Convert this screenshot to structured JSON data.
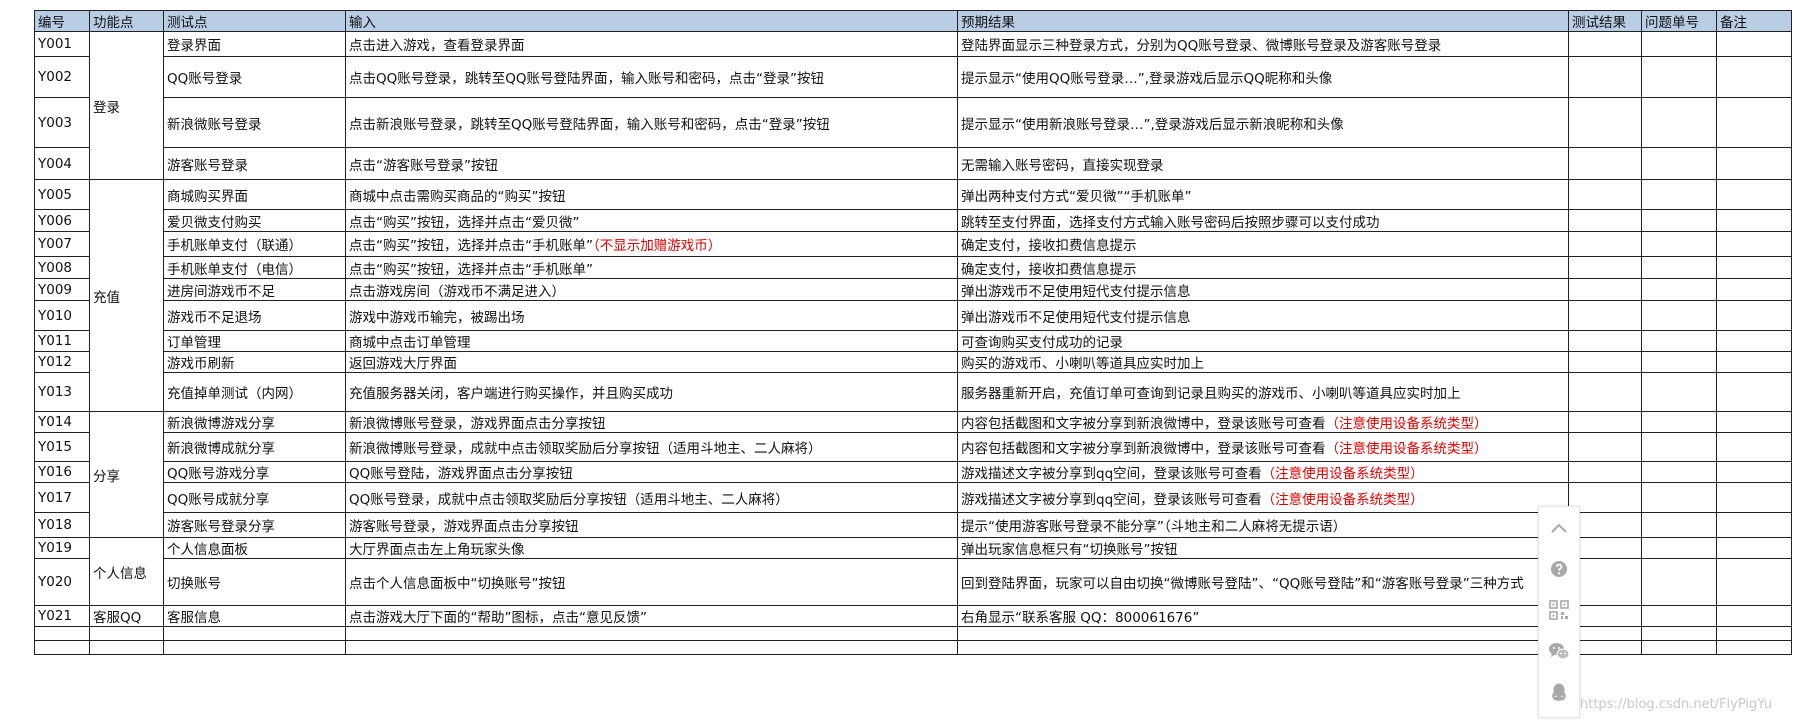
{
  "table": {
    "headers": [
      "编号",
      "功能点",
      "测试点",
      "输入",
      "预期结果",
      "测试结果",
      "问题单号",
      "备注"
    ],
    "rows": [
      {
        "id": "Y001",
        "point": "登录界面",
        "input": "点击进入游戏，查看登录界面",
        "input_note": "",
        "expected": "登陆界面显示三种登录方式，分别为QQ账号登录、微博账号登录及游客账号登录",
        "expected_note": ""
      },
      {
        "id": "Y002",
        "point": "QQ账号登录",
        "input": "点击QQ账号登录，跳转至QQ账号登陆界面，输入账号和密码，点击“登录”按钮",
        "input_note": "",
        "expected": "提示显示“使用QQ账号登录…”,登录游戏后显示QQ昵称和头像",
        "expected_note": ""
      },
      {
        "id": "Y003",
        "point": "新浪微账号登录",
        "input": "点击新浪账号登录，跳转至QQ账号登陆界面，输入账号和密码，点击“登录”按钮",
        "input_note": "",
        "expected": "提示显示“使用新浪账号登录…”,登录游戏后显示新浪昵称和头像",
        "expected_note": ""
      },
      {
        "id": "Y004",
        "point": "游客账号登录",
        "input": "点击“游客账号登录”按钮",
        "input_note": "",
        "expected": "无需输入账号密码，直接实现登录",
        "expected_note": ""
      },
      {
        "id": "Y005",
        "point": "商城购买界面",
        "input": "商城中点击需购买商品的“购买”按钮",
        "input_note": "",
        "expected": "弹出两种支付方式“爱贝微”“手机账单”",
        "expected_note": ""
      },
      {
        "id": "Y006",
        "point": "爱贝微支付购买",
        "input": "点击“购买”按钮，选择并点击“爱贝微”",
        "input_note": "",
        "expected": "跳转至支付界面，选择支付方式输入账号密码后按照步骤可以支付成功",
        "expected_note": ""
      },
      {
        "id": "Y007",
        "point": "手机账单支付（联通）",
        "input": "点击“购买”按钮，选择并点击“手机账单”",
        "input_note": "（不显示加赠游戏币）",
        "expected": "确定支付，接收扣费信息提示",
        "expected_note": ""
      },
      {
        "id": "Y008",
        "point": "手机账单支付（电信）",
        "input": "点击“购买”按钮，选择并点击“手机账单”",
        "input_note": "",
        "expected": "确定支付，接收扣费信息提示",
        "expected_note": ""
      },
      {
        "id": "Y009",
        "point": "进房间游戏币不足",
        "input": "点击游戏房间（游戏币不满足进入）",
        "input_note": "",
        "expected": "弹出游戏币不足使用短代支付提示信息",
        "expected_note": ""
      },
      {
        "id": "Y010",
        "point": "游戏币不足退场",
        "input": "游戏中游戏币输完，被踢出场",
        "input_note": "",
        "expected": "弹出游戏币不足使用短代支付提示信息",
        "expected_note": ""
      },
      {
        "id": "Y011",
        "point": "订单管理",
        "input": "商城中点击订单管理",
        "input_note": "",
        "expected": "可查询购买支付成功的记录",
        "expected_note": ""
      },
      {
        "id": "Y012",
        "point": "游戏币刷新",
        "input": "返回游戏大厅界面",
        "input_note": "",
        "expected": "购买的游戏币、小喇叭等道具应实时加上",
        "expected_note": ""
      },
      {
        "id": "Y013",
        "point": "充值掉单测试（内网）",
        "input": "充值服务器关闭，客户端进行购买操作，并且购买成功",
        "input_note": "",
        "expected": "服务器重新开启，充值订单可查询到记录且购买的游戏币、小喇叭等道具应实时加上",
        "expected_note": ""
      },
      {
        "id": "Y014",
        "point": "新浪微博游戏分享",
        "input": "新浪微博账号登录，游戏界面点击分享按钮",
        "input_note": "",
        "expected": "内容包括截图和文字被分享到新浪微博中，登录该账号可查看",
        "expected_note": "（注意使用设备系统类型）"
      },
      {
        "id": "Y015",
        "point": "新浪微博成就分享",
        "input": "新浪微博账号登录，成就中点击领取奖励后分享按钮（适用斗地主、二人麻将）",
        "input_note": "",
        "expected": "内容包括截图和文字被分享到新浪微博中，登录该账号可查看",
        "expected_note": "（注意使用设备系统类型）"
      },
      {
        "id": "Y016",
        "point": "QQ账号游戏分享",
        "input": "QQ账号登陆，游戏界面点击分享按钮",
        "input_note": "",
        "expected": "游戏描述文字被分享到qq空间，登录该账号可查看",
        "expected_note": "（注意使用设备系统类型）"
      },
      {
        "id": "Y017",
        "point": "QQ账号成就分享",
        "input": "QQ账号登录，成就中点击领取奖励后分享按钮（适用斗地主、二人麻将）",
        "input_note": "",
        "expected": "游戏描述文字被分享到qq空间，登录该账号可查看",
        "expected_note": "（注意使用设备系统类型）"
      },
      {
        "id": "Y018",
        "point": "游客账号登录分享",
        "input": "游客账号登录，游戏界面点击分享按钮",
        "input_note": "",
        "expected": "提示“使用游客账号登录不能分享”（斗地主和二人麻将无提示语）",
        "expected_note": ""
      },
      {
        "id": "Y019",
        "point": "个人信息面板",
        "input": "大厅界面点击左上角玩家头像",
        "input_note": "",
        "expected": "弹出玩家信息框只有“切换账号”按钮",
        "expected_note": ""
      },
      {
        "id": "Y020",
        "point": "切换账号",
        "input": "点击个人信息面板中“切换账号”按钮",
        "input_note": "",
        "expected": "回到登陆界面，玩家可以自由切换“微博账号登陆”、“QQ账号登陆”和“游客账号登录”三种方式",
        "expected_note": ""
      },
      {
        "id": "Y021",
        "point": "客服信息",
        "input": "点击游戏大厅下面的“帮助”图标，点击“意见反馈”",
        "input_note": "",
        "expected": "右角显示“联系客服 QQ：800061676”",
        "expected_note": ""
      }
    ],
    "groups": [
      {
        "label": "登录"
      },
      {
        "label": "充值"
      },
      {
        "label": "分享"
      },
      {
        "label": "个人信息"
      },
      {
        "label": "客服QQ"
      }
    ]
  },
  "side_tools": {
    "icons": [
      "chevron-up-icon",
      "help-icon",
      "qr-code-icon",
      "wechat-icon",
      "qq-icon"
    ]
  },
  "watermark": "https://blog.csdn.net/FlyPigYu",
  "colors": {
    "header_bg": "#b9cde5",
    "note_red": "#e00000",
    "border": "#222222"
  }
}
